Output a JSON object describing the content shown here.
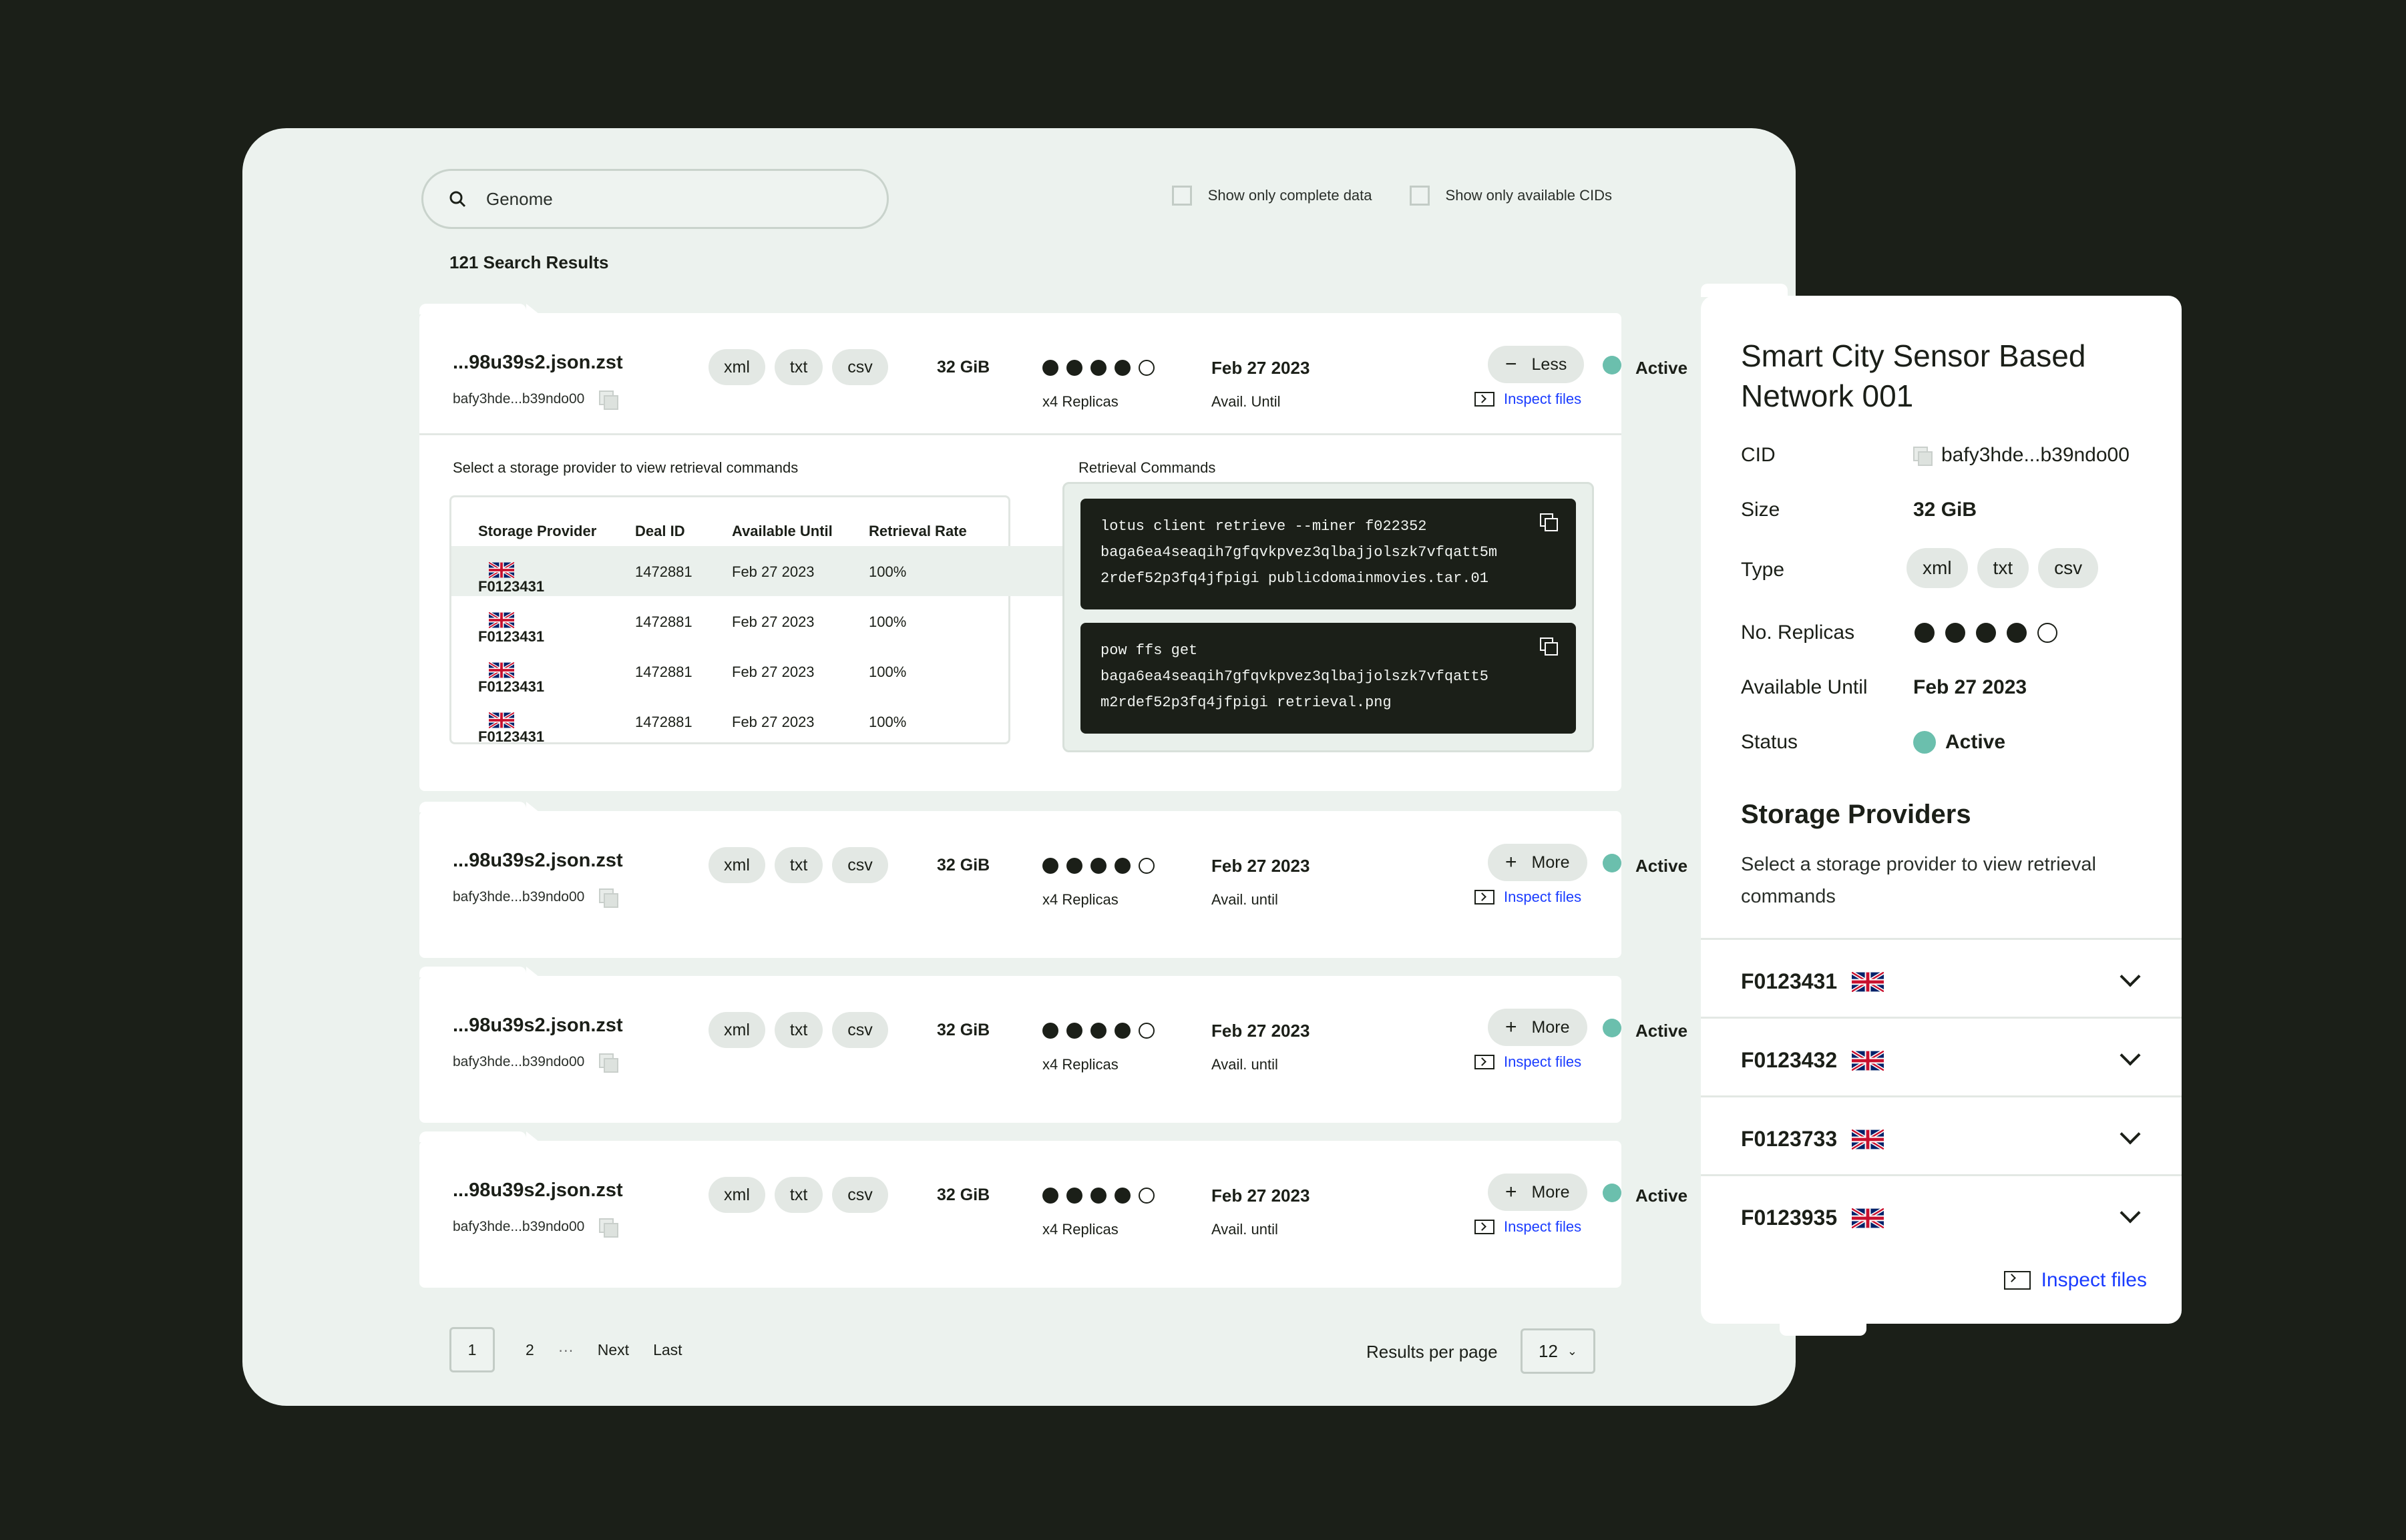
{
  "search": {
    "value": "Genome"
  },
  "filters": {
    "complete": "Show only complete data",
    "available": "Show only available CIDs"
  },
  "results_count": "121 Search Results",
  "results": [
    {
      "name": "...98u39s2.json.zst",
      "cid": "bafy3hde...b39ndo00",
      "tags": [
        "xml",
        "txt",
        "csv"
      ],
      "size": "32 GiB",
      "replicas_filled": 4,
      "replicas_total": 5,
      "replicas_label": "x4 Replicas",
      "date": "Feb 27 2023",
      "avail_label": "Avail. Until",
      "status": "Active",
      "button": "Less",
      "button_sign": "−",
      "inspect": "Inspect files"
    },
    {
      "name": "...98u39s2.json.zst",
      "cid": "bafy3hde...b39ndo00",
      "tags": [
        "xml",
        "txt",
        "csv"
      ],
      "size": "32 GiB",
      "replicas_filled": 4,
      "replicas_total": 5,
      "replicas_label": "x4 Replicas",
      "date": "Feb 27 2023",
      "avail_label": "Avail. until",
      "status": "Active",
      "button": "More",
      "button_sign": "+",
      "inspect": "Inspect files"
    },
    {
      "name": "...98u39s2.json.zst",
      "cid": "bafy3hde...b39ndo00",
      "tags": [
        "xml",
        "txt",
        "csv"
      ],
      "size": "32 GiB",
      "replicas_filled": 4,
      "replicas_total": 5,
      "replicas_label": "x4 Replicas",
      "date": "Feb 27 2023",
      "avail_label": "Avail. until",
      "status": "Active",
      "button": "More",
      "button_sign": "+",
      "inspect": "Inspect files"
    },
    {
      "name": "...98u39s2.json.zst",
      "cid": "bafy3hde...b39ndo00",
      "tags": [
        "xml",
        "txt",
        "csv"
      ],
      "size": "32 GiB",
      "replicas_filled": 4,
      "replicas_total": 5,
      "replicas_label": "x4 Replicas",
      "date": "Feb 27 2023",
      "avail_label": "Avail. until",
      "status": "Active",
      "button": "More",
      "button_sign": "+",
      "inspect": "Inspect files"
    }
  ],
  "expanded": {
    "prompt": "Select a storage provider to view retrieval commands",
    "headers": [
      "Storage Provider",
      "Deal ID",
      "Available Until",
      "Retrieval Rate"
    ],
    "rows": [
      {
        "provider": "F0123431",
        "deal": "1472881",
        "until": "Feb 27 2023",
        "rate": "100%"
      },
      {
        "provider": "F0123431",
        "deal": "1472881",
        "until": "Feb 27 2023",
        "rate": "100%"
      },
      {
        "provider": "F0123431",
        "deal": "1472881",
        "until": "Feb 27 2023",
        "rate": "100%"
      },
      {
        "provider": "F0123431",
        "deal": "1472881",
        "until": "Feb 27 2023",
        "rate": "100%"
      }
    ],
    "commands_label": "Retrieval Commands",
    "commands": [
      "lotus client retrieve --miner f022352\nbaga6ea4seaqih7gfqvkpvez3qlbajjolszk7vfqatt5m\n2rdef52p3fq4jfpigi publicdomainmovies.tar.01",
      "pow ffs get\nbaga6ea4seaqih7gfqvkpvez3qlbajjolszk7vfqatt5\nm2rdef52p3fq4jfpigi retrieval.png"
    ]
  },
  "pagination": {
    "pages": [
      "1",
      "2",
      "···",
      "Next",
      "Last"
    ],
    "per_page_label": "Results per page",
    "per_page": "12"
  },
  "panel": {
    "title": "Smart City Sensor Based Network 001",
    "cid_label": "CID",
    "cid": "bafy3hde...b39ndo00",
    "size_label": "Size",
    "size": "32 GiB",
    "type_label": "Type",
    "types": [
      "xml",
      "txt",
      "csv"
    ],
    "replicas_label": "No. Replicas",
    "replicas_filled": 4,
    "replicas_total": 5,
    "until_label": "Available Until",
    "until": "Feb 27 2023",
    "status_label": "Status",
    "status": "Active",
    "sp_title": "Storage Providers",
    "sp_desc": "Select a storage provider to view retrieval commands",
    "providers": [
      "F0123431",
      "F0123432",
      "F0123733",
      "F0123935"
    ],
    "inspect": "Inspect files"
  },
  "colors": {
    "accent_link": "#1a3cff",
    "status_active": "#6bbfad",
    "background": "#1b1f18",
    "card_bg": "#ecf2ee"
  }
}
